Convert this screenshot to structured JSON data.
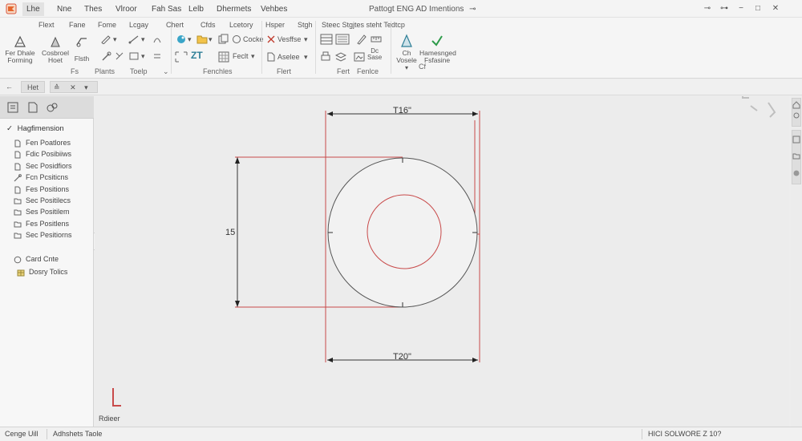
{
  "menubar": {
    "items": [
      "Lhe",
      "Nne",
      "Thes",
      "Vlroor",
      "Fah Sas",
      "Lelb",
      "Dhermets",
      "Vehbes"
    ],
    "active_index": 0,
    "title": "Pattogt ENG AD Imentions",
    "title_suffix": "⊸",
    "buttons": [
      "⊸",
      "⊶",
      "−",
      "□",
      "✕"
    ]
  },
  "ribbon": {
    "tabs_row": [
      "Flext",
      "Fane",
      "Fome",
      "Lcgay",
      "Chert",
      "Cfds",
      "Lcetory",
      "Hsper",
      "Stgh",
      "Steec Stgjtes steht Tedtcp"
    ],
    "tools": [
      {
        "label": "Fer Dhale Forming"
      },
      {
        "label": "Cosbroel Hoet"
      },
      {
        "label": "Flsth"
      },
      {
        "label": "Vosele"
      },
      {
        "label": "Hamesnged Fsfasine"
      }
    ],
    "small_tools": {
      "cocke": "Cocke",
      "feclt": "Feclt",
      "vesffse": "Vesffse",
      "aselee": "Aselee",
      "dc": "Dc",
      "sase": "Sase",
      "zt": "ZT",
      "ch": "Ch",
      "cf": "Cf"
    },
    "groups": [
      "Fs",
      "Plants",
      "Toelp",
      "Fenchles",
      "Flert",
      "Fert",
      "Fenlce"
    ]
  },
  "cmdrow": {
    "buttons": [
      "Het",
      "≙",
      "✕"
    ]
  },
  "panel": {
    "root": "Hagfimension",
    "items": [
      {
        "label": "Fen Poatlores",
        "icon": "doc-icon"
      },
      {
        "label": "Fdic Posibiiws",
        "icon": "doc-icon"
      },
      {
        "label": "Sec Posidfiors",
        "icon": "doc-icon"
      },
      {
        "label": "Fcn Pcsiticns",
        "icon": "sketch-icon"
      },
      {
        "label": "Fes Positions",
        "icon": "doc-icon"
      },
      {
        "label": "Sec Positilecs",
        "icon": "folder-icon"
      },
      {
        "label": "Ses Positilem",
        "icon": "folder-icon"
      },
      {
        "label": "Fes Positlens",
        "icon": "folder-icon"
      },
      {
        "label": "Sec Pesitiorns",
        "icon": "folder-icon"
      },
      {
        "label": "Card Cnte",
        "icon": "circle-icon"
      },
      {
        "label": "Dosry Tolics",
        "icon": "table-icon"
      }
    ]
  },
  "drawing": {
    "dim_top": "T16\"",
    "dim_bottom": "T20\"",
    "dim_left": "15",
    "axis_label": "Rdieer"
  },
  "statusbar": {
    "left1": "Cenge Uill",
    "left2": "Adhshets Taole",
    "right": "HICI SOLWORE Z 10?"
  }
}
